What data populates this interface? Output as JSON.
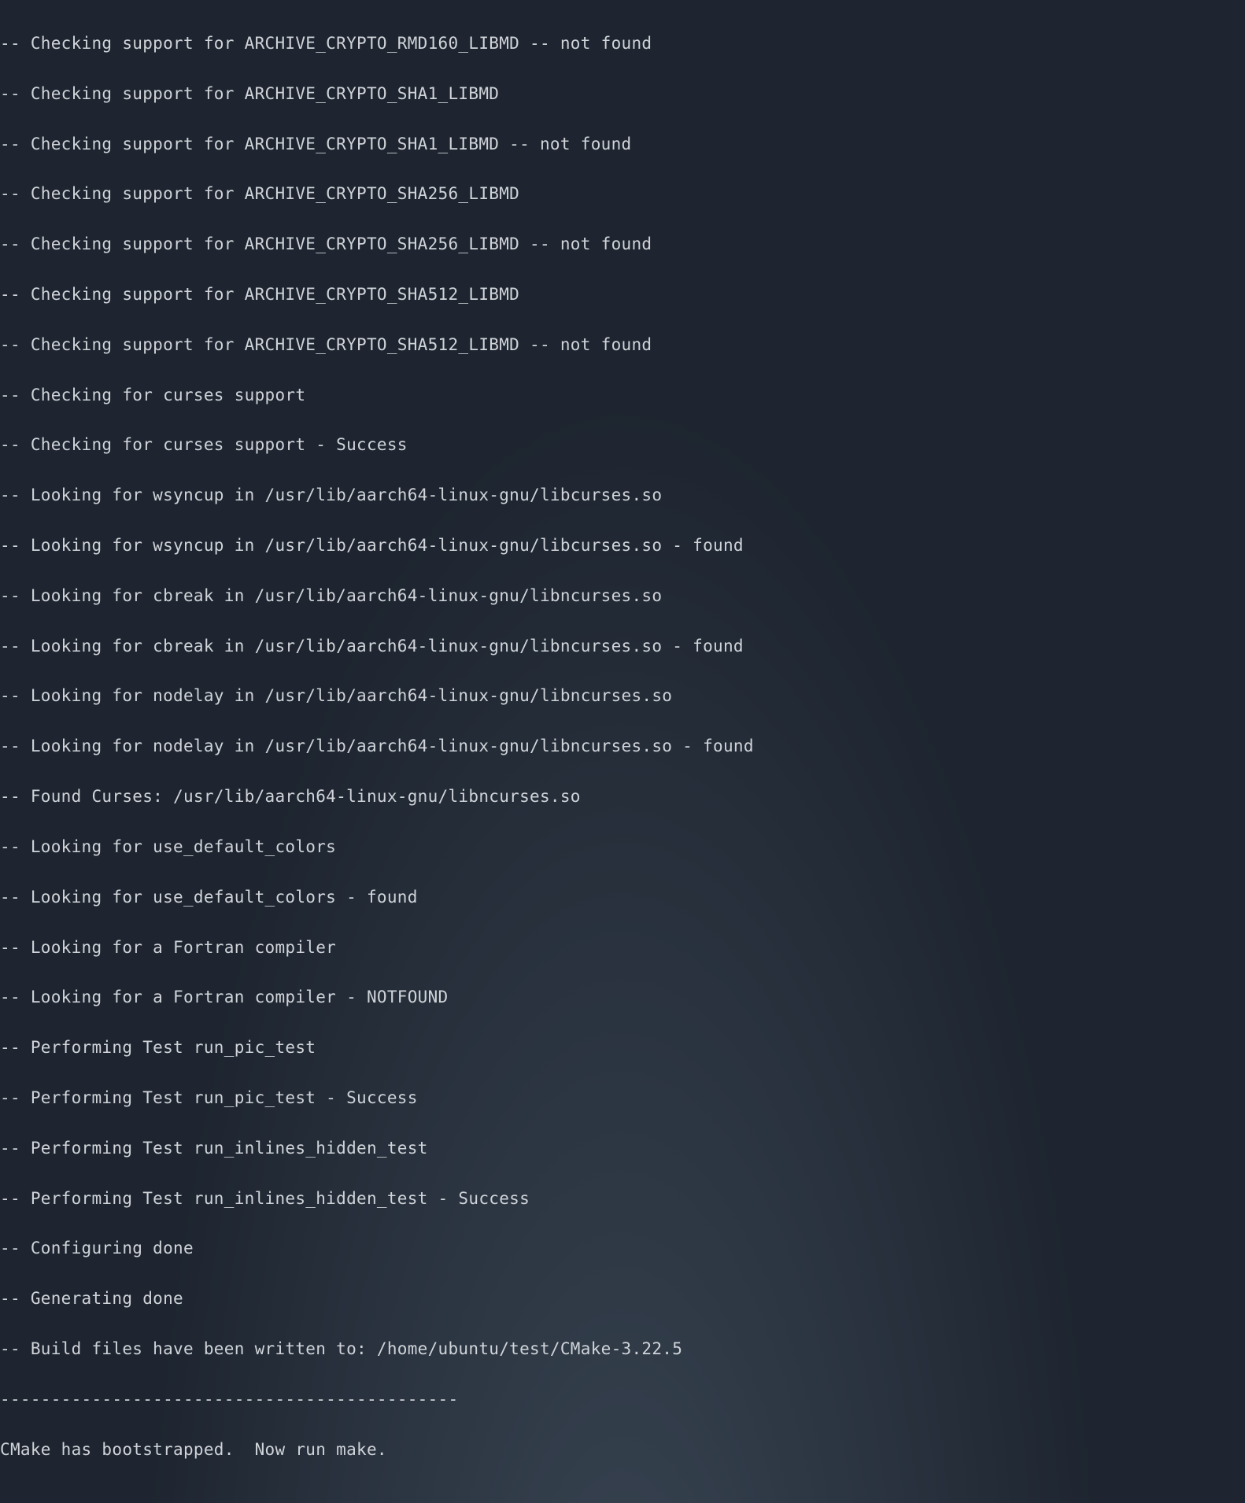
{
  "terminal": {
    "lines": [
      "-- Checking support for ARCHIVE_CRYPTO_RMD160_LIBMD -- not found",
      "-- Checking support for ARCHIVE_CRYPTO_SHA1_LIBMD",
      "-- Checking support for ARCHIVE_CRYPTO_SHA1_LIBMD -- not found",
      "-- Checking support for ARCHIVE_CRYPTO_SHA256_LIBMD",
      "-- Checking support for ARCHIVE_CRYPTO_SHA256_LIBMD -- not found",
      "-- Checking support for ARCHIVE_CRYPTO_SHA512_LIBMD",
      "-- Checking support for ARCHIVE_CRYPTO_SHA512_LIBMD -- not found",
      "-- Checking for curses support",
      "-- Checking for curses support - Success",
      "-- Looking for wsyncup in /usr/lib/aarch64-linux-gnu/libcurses.so",
      "-- Looking for wsyncup in /usr/lib/aarch64-linux-gnu/libcurses.so - found",
      "-- Looking for cbreak in /usr/lib/aarch64-linux-gnu/libncurses.so",
      "-- Looking for cbreak in /usr/lib/aarch64-linux-gnu/libncurses.so - found",
      "-- Looking for nodelay in /usr/lib/aarch64-linux-gnu/libncurses.so",
      "-- Looking for nodelay in /usr/lib/aarch64-linux-gnu/libncurses.so - found",
      "-- Found Curses: /usr/lib/aarch64-linux-gnu/libncurses.so",
      "-- Looking for use_default_colors",
      "-- Looking for use_default_colors - found",
      "-- Looking for a Fortran compiler",
      "-- Looking for a Fortran compiler - NOTFOUND",
      "-- Performing Test run_pic_test",
      "-- Performing Test run_pic_test - Success",
      "-- Performing Test run_inlines_hidden_test",
      "-- Performing Test run_inlines_hidden_test - Success",
      "-- Configuring done",
      "-- Generating done",
      "-- Build files have been written to: /home/ubuntu/test/CMake-3.22.5",
      "---------------------------------------------",
      "CMake has bootstrapped.  Now run make."
    ]
  }
}
